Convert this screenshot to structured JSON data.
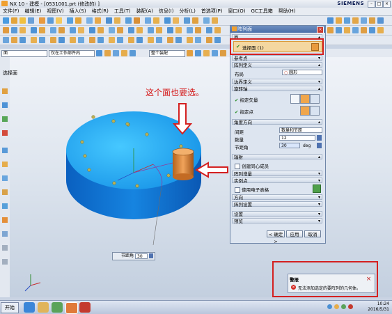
{
  "window": {
    "title": "NX 10 - 建模 - [0531001.prt (修改的) ]",
    "brand": "SIEMENS",
    "controls": [
      "–",
      "□",
      "×"
    ]
  },
  "menubar": [
    "文件(F)",
    "编辑(E)",
    "视图(V)",
    "插入(S)",
    "格式(R)",
    "工具(T)",
    "装配(A)",
    "信息(I)",
    "分析(L)",
    "首选项(P)",
    "窗口(O)",
    "GC工具箱",
    "帮助(H)"
  ],
  "filter": {
    "type_value": "面",
    "scope_value": "仅在工作部件内",
    "snap_value": "整个装配"
  },
  "viewport": {
    "label": "选择面",
    "annotation": "这个面也要选。"
  },
  "dialog": {
    "title": "阵列面",
    "sections": {
      "face": "面",
      "select_face_label": "选择面 (1)",
      "reference": "参考点",
      "array_def": "阵列定义",
      "layout_label": "布局",
      "layout_value": "圆形",
      "boundary": "边界定义",
      "rotation_axis": "旋转轴",
      "specify_vector": "指定矢量",
      "specify_point": "指定点",
      "angular_dir": "角度方向",
      "spacing_label": "间距",
      "spacing_value": "数量和节距",
      "count_label": "数量",
      "count_value": "12",
      "pitch_label": "节距角",
      "pitch_value": "30",
      "pitch_unit": "deg",
      "radiate": "辐射",
      "create_concentric": "创建同心成员",
      "pattern_increment": "阵列增量",
      "instance_points": "实例点",
      "use_spreadsheet": "使用电子表格",
      "orientation": "方向",
      "pattern_settings": "阵列设置",
      "settings": "设置",
      "preview": "预览"
    },
    "buttons": {
      "ok": "< 确定 >",
      "apply": "应用",
      "cancel": "取消"
    }
  },
  "pitch_popup": {
    "label": "节距角",
    "value": "30"
  },
  "alert": {
    "title": "警报",
    "message": "无法添加选定的要阵列的几何体。",
    "close": "×"
  },
  "taskbar": {
    "start": "开始",
    "time": "10:24",
    "date": "2016/5/31"
  },
  "colors": {
    "accent_red": "#d42020",
    "model_blue": "#1591e6",
    "cylinder_orange": "#e09245"
  }
}
